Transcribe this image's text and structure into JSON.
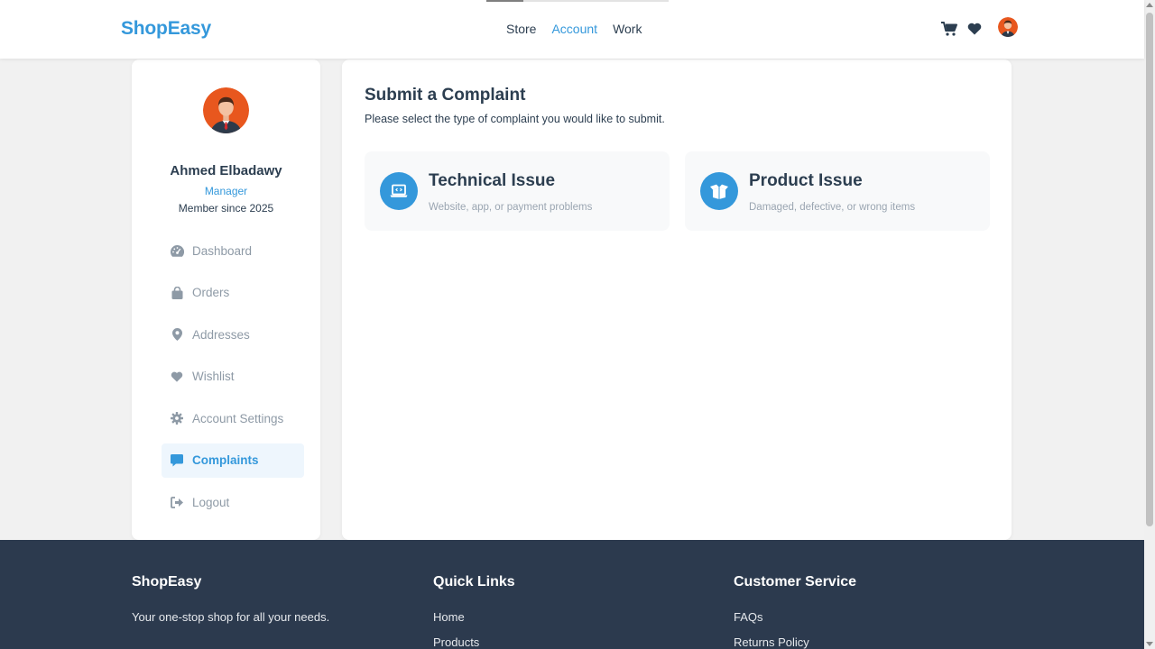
{
  "header": {
    "brand": "ShopEasy",
    "nav": [
      "Store",
      "Account",
      "Work"
    ],
    "active_nav": "Account",
    "icons": [
      "cart-icon",
      "heart-icon",
      "user-avatar"
    ]
  },
  "profile": {
    "name": "Ahmed Elbadawy",
    "role": "Manager",
    "member_since": "Member since 2025"
  },
  "sidebar": {
    "items": [
      {
        "label": "Dashboard",
        "icon": "dashboard-icon",
        "active": false
      },
      {
        "label": "Orders",
        "icon": "shopping-bag-icon",
        "active": false
      },
      {
        "label": "Addresses",
        "icon": "map-pin-icon",
        "active": false
      },
      {
        "label": "Wishlist",
        "icon": "heart-icon",
        "active": false
      },
      {
        "label": "Account Settings",
        "icon": "gear-icon",
        "active": false
      },
      {
        "label": "Complaints",
        "icon": "comment-icon",
        "active": true
      },
      {
        "label": "Logout",
        "icon": "logout-icon",
        "active": false
      }
    ]
  },
  "main": {
    "title": "Submit a Complaint",
    "subtitle": "Please select the type of complaint you would like to submit.",
    "cards": [
      {
        "title": "Technical Issue",
        "description": "Website, app, or payment problems",
        "icon": "laptop-code-icon"
      },
      {
        "title": "Product Issue",
        "description": "Damaged, defective, or wrong items",
        "icon": "box-open-icon"
      }
    ]
  },
  "footer": {
    "brand": "ShopEasy",
    "tagline": "Your one-stop shop for all your needs.",
    "quick_links_title": "Quick Links",
    "quick_links": [
      "Home",
      "Products"
    ],
    "customer_service_title": "Customer Service",
    "customer_service": [
      "FAQs",
      "Returns Policy"
    ]
  },
  "colors": {
    "accent": "#3498db",
    "text_dark": "#2c3e50",
    "muted": "#8e9aa6",
    "footer_bg": "#2c3a4e",
    "page_bg": "#f1f1f1"
  }
}
